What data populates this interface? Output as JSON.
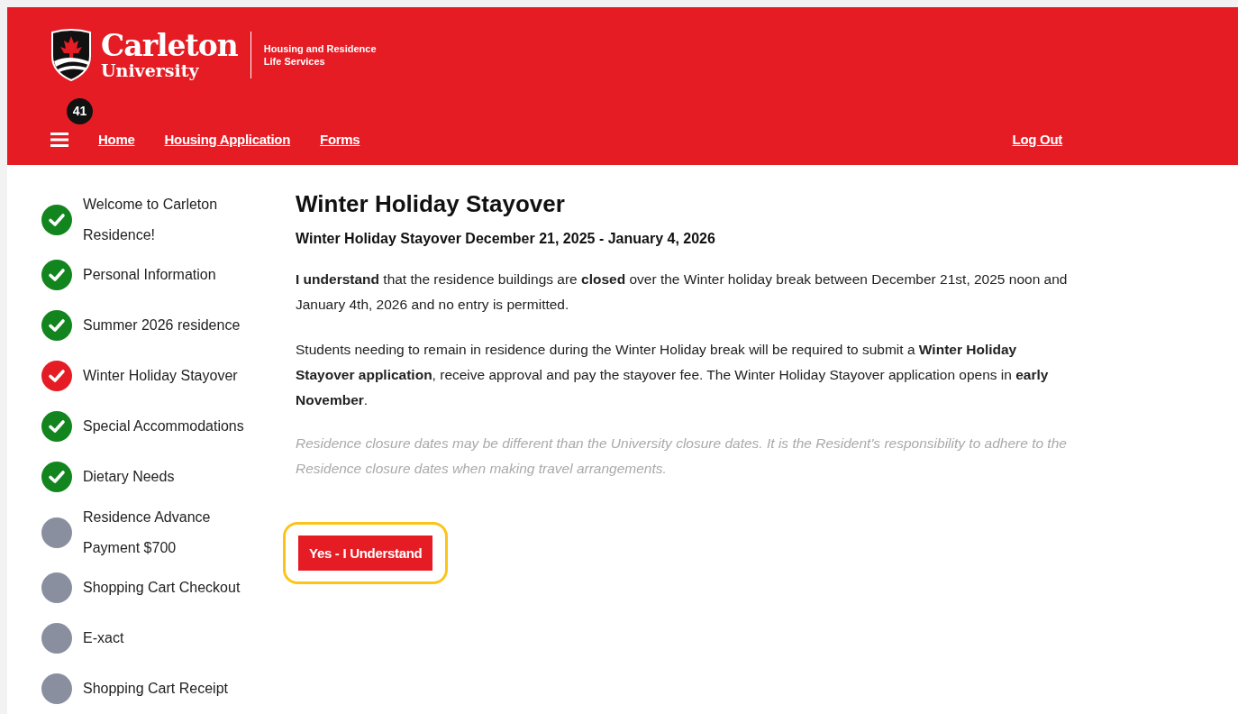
{
  "header": {
    "logo": {
      "name": "Carleton",
      "subname": "University",
      "department": [
        "Housing and Residence",
        "Life Services"
      ]
    },
    "notification_count": "41",
    "nav": [
      {
        "label": "Home"
      },
      {
        "label": "Housing Application"
      },
      {
        "label": "Forms"
      }
    ],
    "logout": "Log Out"
  },
  "steps": [
    {
      "label": "Welcome to Carleton Residence!",
      "kind": "done"
    },
    {
      "label": "Personal Information",
      "kind": "done"
    },
    {
      "label": "Summer 2026 residence",
      "kind": "done"
    },
    {
      "label": "Winter Holiday Stayover",
      "kind": "current"
    },
    {
      "label": "Special Accommodations",
      "kind": "done"
    },
    {
      "label": "Dietary Needs",
      "kind": "done"
    },
    {
      "label": "Residence Advance Payment $700",
      "kind": "todo"
    },
    {
      "label": "Shopping Cart Checkout",
      "kind": "todo"
    },
    {
      "label": "E-xact",
      "kind": "todo"
    },
    {
      "label": "Shopping Cart Receipt",
      "kind": "todo"
    }
  ],
  "content": {
    "title": "Winter Holiday Stayover",
    "subtitle": "Winter Holiday Stayover December 21, 2025 - January 4, 2026",
    "paragraphs": [
      {
        "kind": "body",
        "text": "**I understand** that the residence buildings are **closed** over the Winter holiday break between December 21st, 2025 noon and January 4th, 2026 and no entry is permitted."
      },
      {
        "kind": "body",
        "text": "Students needing to remain in residence during the Winter Holiday break will be required to submit a **Winter Holiday Stayover application**, receive approval and pay the stayover fee. The Winter Holiday Stayover application opens in **early November**."
      },
      {
        "kind": "note",
        "text": "Residence closure dates may be different than the University closure dates. It is the Resident's responsibility to adhere to the Residence closure dates when making travel arrangements."
      }
    ],
    "button": {
      "label": "Yes - I Understand",
      "highlighted": true
    }
  }
}
